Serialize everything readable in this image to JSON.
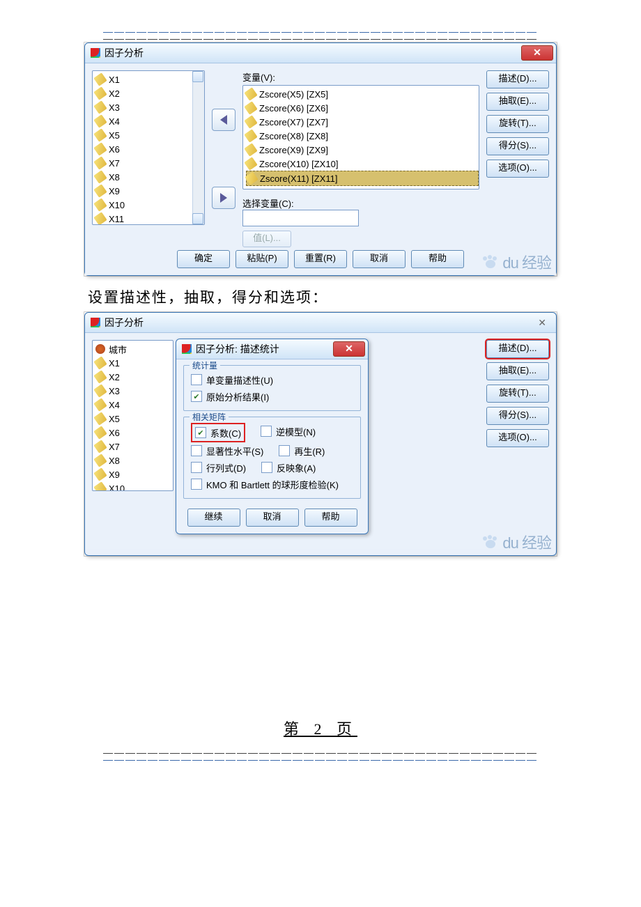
{
  "dialog1": {
    "title": "因子分析",
    "close": "✕",
    "src_vars": [
      "X1",
      "X2",
      "X3",
      "X4",
      "X5",
      "X6",
      "X7",
      "X8",
      "X9",
      "X10",
      "X11"
    ],
    "variables_label": "变量(V):",
    "variables": [
      "Zscore(X5) [ZX5]",
      "Zscore(X6) [ZX6]",
      "Zscore(X7) [ZX7]",
      "Zscore(X8) [ZX8]",
      "Zscore(X9) [ZX9]",
      "Zscore(X10) [ZX10]",
      "Zscore(X11) [ZX11]"
    ],
    "select_label": "选择变量(C):",
    "value_btn": "值(L)...",
    "side": [
      "描述(D)...",
      "抽取(E)...",
      "旋转(T)...",
      "得分(S)...",
      "选项(O)..."
    ],
    "buttons": {
      "ok": "确定",
      "paste": "粘贴(P)",
      "reset": "重置(R)",
      "cancel": "取消",
      "help": "帮助"
    }
  },
  "caption": "设置描述性，抽取，得分和选项：",
  "dialog2": {
    "title": "因子分析",
    "close": "✕",
    "src_vars": [
      "城市",
      "X1",
      "X2",
      "X3",
      "X4",
      "X5",
      "X6",
      "X7",
      "X8",
      "X9",
      "X10"
    ],
    "side": [
      "描述(D)...",
      "抽取(E)...",
      "旋转(T)...",
      "得分(S)...",
      "选项(O)..."
    ],
    "close2": "✕",
    "inner_title": "因子分析: 描述统计",
    "grp1_title": "统计量",
    "grp1": {
      "uni": "单变量描述性(U)",
      "init": "原始分析结果(I)"
    },
    "grp2_title": "相关矩阵",
    "grp2": {
      "coef": "系数(C)",
      "inv": "逆模型(N)",
      "sig": "显著性水平(S)",
      "repro": "再生(R)",
      "det": "行列式(D)",
      "anti": "反映象(A)",
      "kmo": "KMO 和 Bartlett 的球形度检验(K)"
    },
    "inner_btns": {
      "cont": "继续",
      "cancel": "取消",
      "help": "帮助"
    }
  },
  "watermark": "du 经验",
  "pagenum": "第 2 页"
}
